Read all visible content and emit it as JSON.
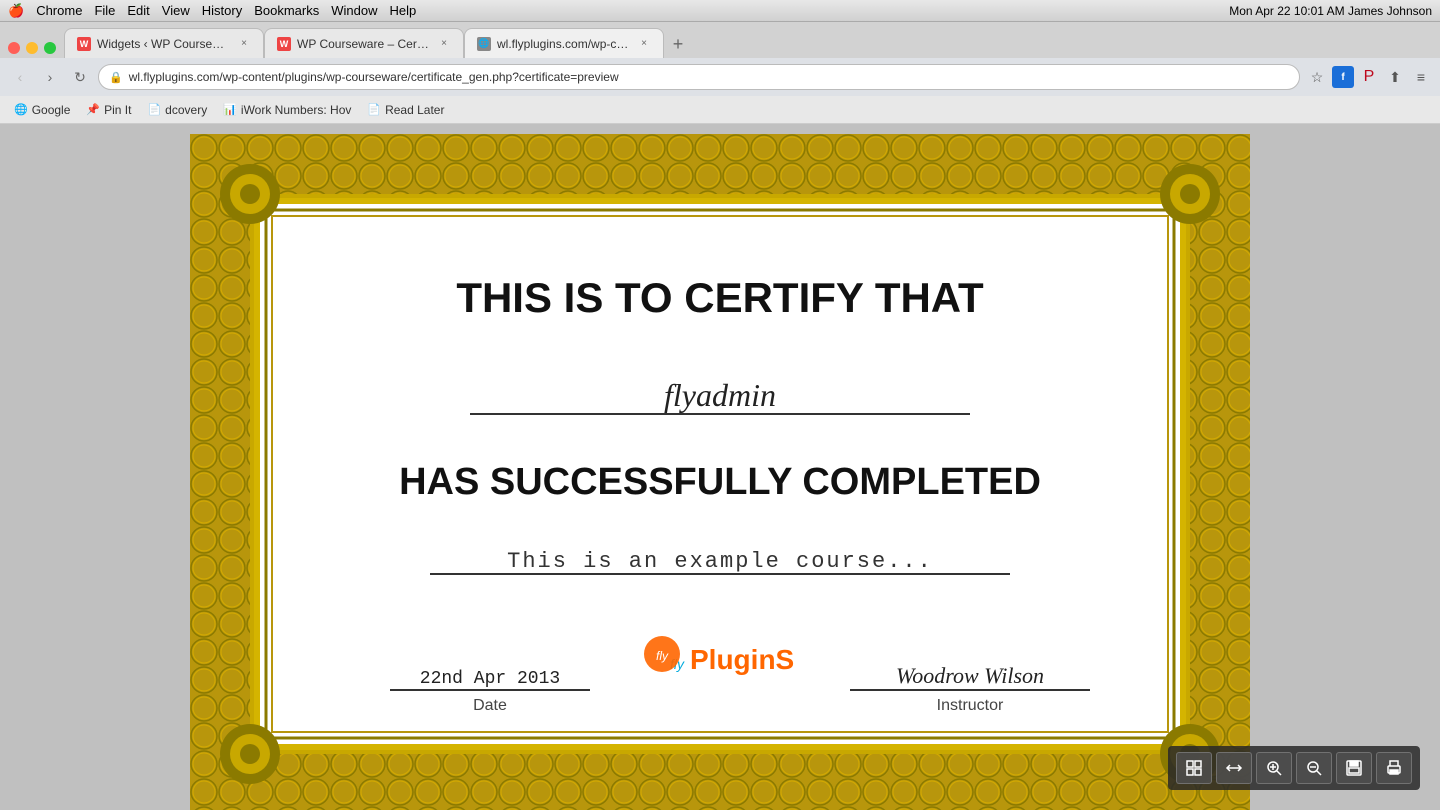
{
  "menubar": {
    "apple": "🍎",
    "items": [
      "Chrome",
      "File",
      "Edit",
      "View",
      "History",
      "Bookmarks",
      "Window",
      "Help"
    ],
    "right": "Mon Apr 22  10:01 AM  James Johnson"
  },
  "tabs": [
    {
      "id": "tab1",
      "label": "Widgets ‹ WP Courseware ...",
      "favicon_color": "#cc3333",
      "active": false
    },
    {
      "id": "tab2",
      "label": "WP Courseware – Certifica...",
      "favicon_color": "#cc3333",
      "active": false
    },
    {
      "id": "tab3",
      "label": "wl.flyplugins.com/wp-con...",
      "favicon_color": "#888",
      "active": true
    }
  ],
  "address_bar": {
    "url": "wl.flyplugins.com/wp-content/plugins/wp-courseware/certificate_gen.php?certificate=preview"
  },
  "bookmarks": [
    {
      "label": "Google",
      "icon": "🌐"
    },
    {
      "label": "Pin It",
      "icon": "📌"
    },
    {
      "label": "dcovery",
      "icon": "📄"
    },
    {
      "label": "iWork Numbers: Hov",
      "icon": "📊"
    },
    {
      "label": "Read Later",
      "icon": "📄"
    }
  ],
  "certificate": {
    "title": "THIS IS TO CERTIFY THAT",
    "name": "flyadmin",
    "subtitle": "HAS SUCCESSFULLY COMPLETED",
    "course": "This is an example course...",
    "date_value": "22nd Apr 2013",
    "date_label": "Date",
    "logo_fly": "fly",
    "logo_plugins": "PluginS",
    "instructor_name": "Woodrow Wilson",
    "instructor_label": "Instructor"
  },
  "pdf_toolbar": {
    "buttons": [
      {
        "icon": "⊞",
        "label": "fit-page",
        "title": "Fit Page"
      },
      {
        "icon": "⇔",
        "label": "fit-width",
        "title": "Fit Width"
      },
      {
        "icon": "🔍",
        "label": "zoom-out-minus",
        "title": "Zoom In"
      },
      {
        "icon": "🔎",
        "label": "zoom-out",
        "title": "Zoom Out"
      },
      {
        "icon": "💾",
        "label": "save",
        "title": "Save"
      },
      {
        "icon": "🖨",
        "label": "print",
        "title": "Print"
      }
    ]
  }
}
